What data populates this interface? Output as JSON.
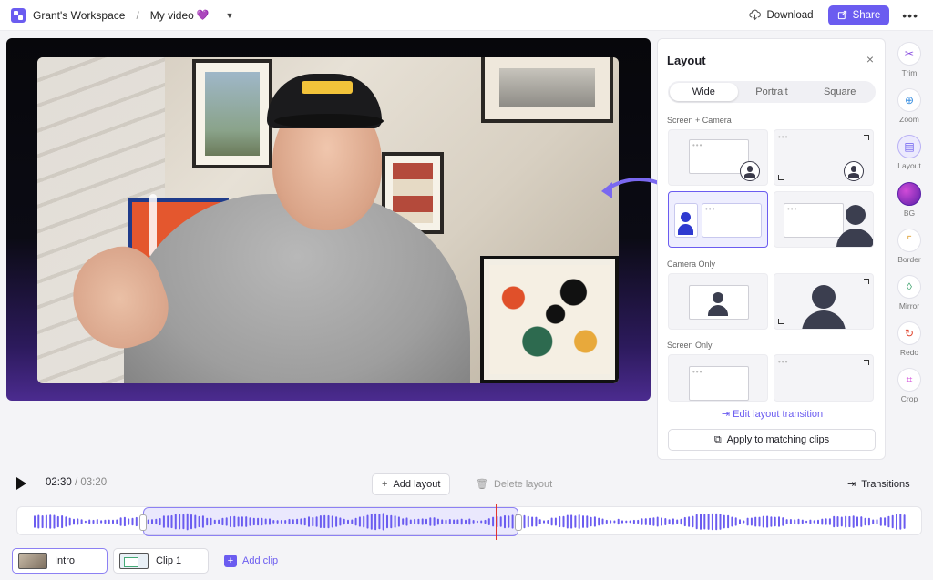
{
  "topbar": {
    "workspace": "Grant's Workspace",
    "separator": "/",
    "video_title": "My video",
    "title_emoji": "💜",
    "download_label": "Download",
    "share_label": "Share",
    "more_label": "•••"
  },
  "layout_panel": {
    "title": "Layout",
    "close_glyph": "×",
    "tabs": [
      {
        "label": "Wide",
        "active": true
      },
      {
        "label": "Portrait",
        "active": false
      },
      {
        "label": "Square",
        "active": false
      }
    ],
    "sections": {
      "screen_camera": "Screen + Camera",
      "camera_only": "Camera Only",
      "screen_only": "Screen Only"
    },
    "selected_tile": "screen-camera-left-split",
    "edit_transition_label": "Edit layout transition",
    "apply_label": "Apply to matching clips"
  },
  "tools": [
    {
      "label": "Trim",
      "icon": "scissors-icon",
      "active": false
    },
    {
      "label": "Zoom",
      "icon": "zoom-icon",
      "active": false
    },
    {
      "label": "Layout",
      "icon": "layout-icon",
      "active": true
    },
    {
      "label": "BG",
      "icon": "background-icon",
      "active": false
    },
    {
      "label": "Border",
      "icon": "border-icon",
      "active": false
    },
    {
      "label": "Mirror",
      "icon": "mirror-icon",
      "active": false
    },
    {
      "label": "Redo",
      "icon": "redo-icon",
      "active": false
    },
    {
      "label": "Crop",
      "icon": "crop-icon",
      "active": false
    }
  ],
  "controls": {
    "current_time": "02:30",
    "time_separator": " / ",
    "total_time": "03:20",
    "add_layout_label": "Add layout",
    "delete_layout_label": "Delete layout",
    "transitions_label": "Transitions"
  },
  "clips": {
    "items": [
      {
        "label": "Intro",
        "active": true
      },
      {
        "label": "Clip 1",
        "active": false
      }
    ],
    "add_label": "Add clip"
  },
  "colors": {
    "accent": "#6b5cf0",
    "playhead": "#e3342f",
    "waveform": "#6b5cf0"
  }
}
